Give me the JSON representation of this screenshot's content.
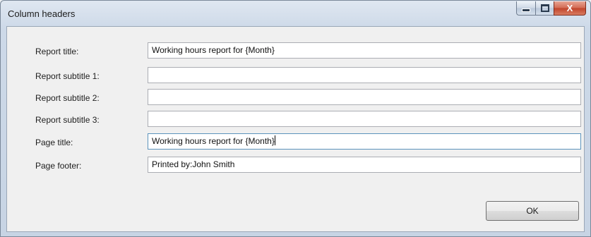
{
  "window": {
    "title": "Column headers"
  },
  "form": {
    "rows": [
      {
        "label": "Report title:",
        "value": "Working hours report for {Month}"
      },
      {
        "label": "Report subtitle 1:",
        "value": ""
      },
      {
        "label": "Report subtitle 2:",
        "value": ""
      },
      {
        "label": "Report subtitle 3:",
        "value": ""
      },
      {
        "label": "Page title:",
        "value": "Working hours report for {Month}"
      },
      {
        "label": "Page footer:",
        "value": "Printed by:John Smith"
      }
    ]
  },
  "buttons": {
    "ok_label": "OK",
    "close_glyph": "X"
  }
}
